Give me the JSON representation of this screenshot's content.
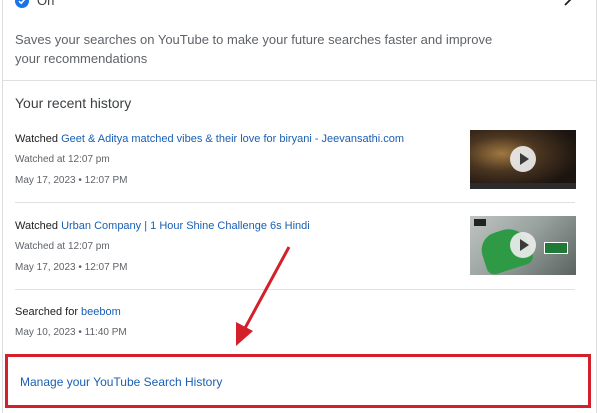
{
  "setting": {
    "status": "On",
    "description": "Saves your searches on YouTube to make your future searches faster and improve your recommendations"
  },
  "recent_history": {
    "title": "Your recent history",
    "items": [
      {
        "action": "Watched",
        "title": "Geet & Aditya matched vibes & their love for biryani - Jeevansathi.com",
        "time": "Watched at 12:07 pm",
        "date": "May 17, 2023 • 12:07 PM"
      },
      {
        "action": "Watched",
        "title": "Urban Company | 1 Hour Shine Challenge 6s Hindi",
        "time": "Watched at 12:07 pm",
        "date": "May 17, 2023 • 12:07 PM"
      },
      {
        "action": "Searched for",
        "title": "beebom",
        "date": "May 10, 2023 • 11:40 PM"
      }
    ]
  },
  "manage_link": "Manage your YouTube Search History",
  "colors": {
    "link": "#1a5fb4",
    "highlight": "#d3202a",
    "check": "#1a73e8"
  },
  "icons": [
    "check-circle-icon",
    "chevron-right-icon",
    "play-icon"
  ]
}
